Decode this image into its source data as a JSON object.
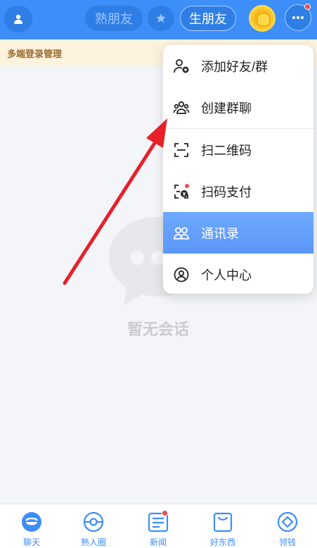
{
  "header": {
    "tab_acquaintance": "熟朋友",
    "tab_stranger": "生朋友"
  },
  "notice": {
    "text": "多端登录管理"
  },
  "empty_state": {
    "text": "暂无会话"
  },
  "menu": {
    "items": [
      {
        "label": "添加好友/群",
        "icon": "add-friend-icon"
      },
      {
        "label": "创建群聊",
        "icon": "group-chat-icon"
      },
      {
        "label": "扫二维码",
        "icon": "scan-icon"
      },
      {
        "label": "扫码支付",
        "icon": "scan-pay-icon"
      },
      {
        "label": "通讯录",
        "icon": "contacts-icon",
        "active": true
      },
      {
        "label": "个人中心",
        "icon": "profile-icon"
      }
    ]
  },
  "tabbar": {
    "items": [
      {
        "label": "聊天",
        "icon": "chat-icon"
      },
      {
        "label": "熟人圈",
        "icon": "circle-icon"
      },
      {
        "label": "新闻",
        "icon": "news-icon"
      },
      {
        "label": "好东西",
        "icon": "shopping-bag-icon"
      },
      {
        "label": "领钱",
        "icon": "money-icon"
      }
    ]
  },
  "colors": {
    "primary": "#3d8ef8",
    "arrow": "#e8202a",
    "badge": "#f04b4b"
  }
}
